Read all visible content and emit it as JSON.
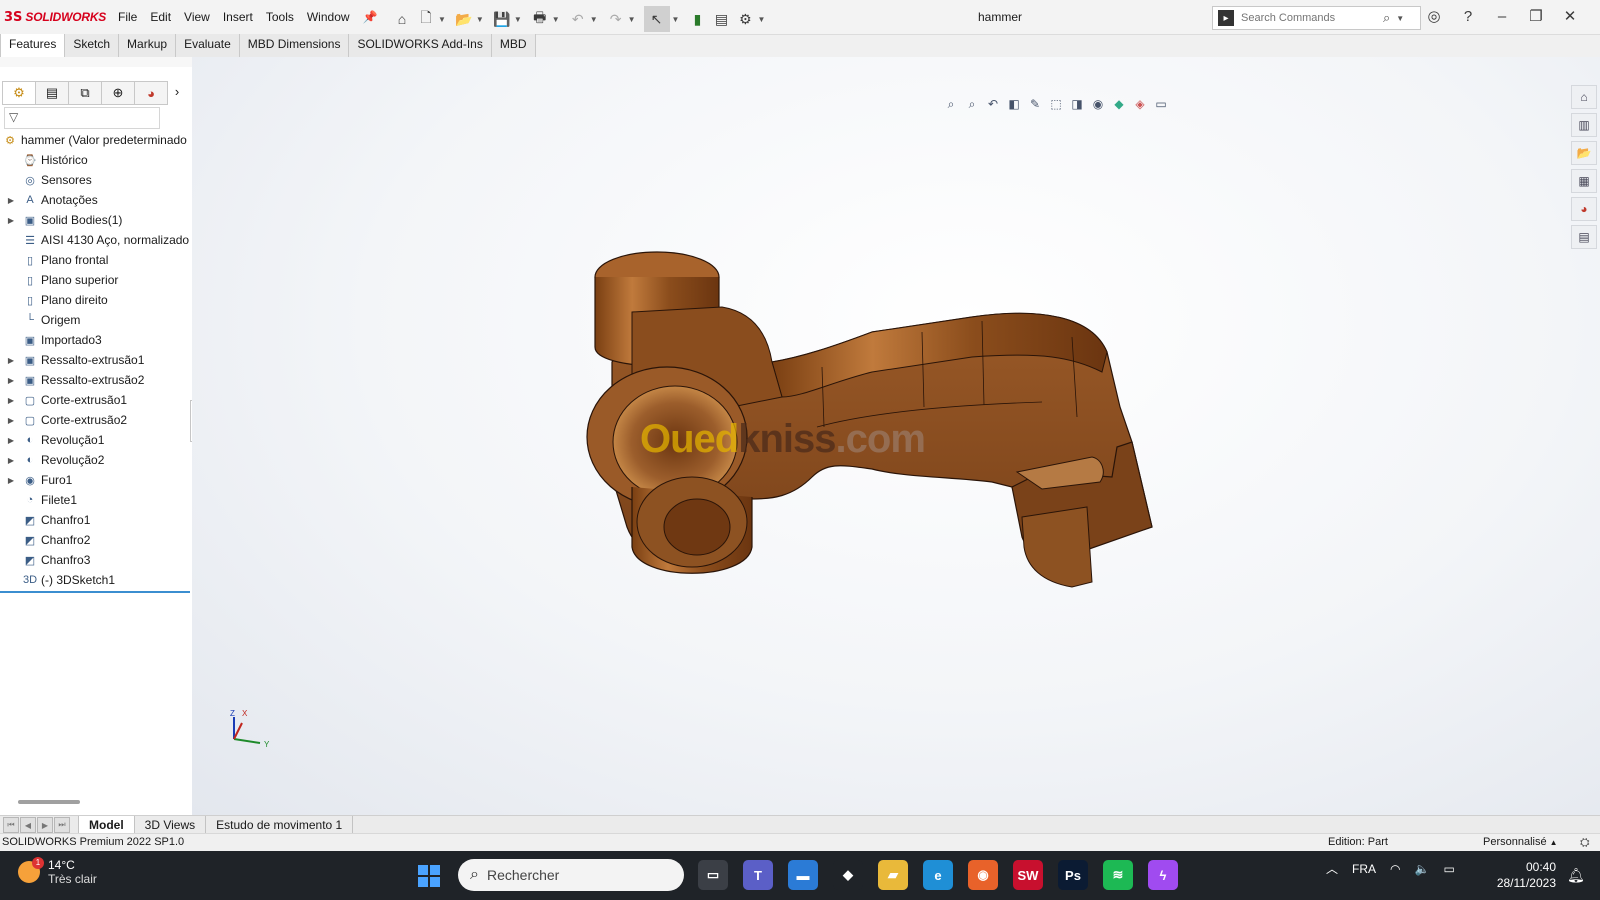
{
  "titlebar": {
    "brand_ds": "3S",
    "brand": "SOLIDWORKS",
    "menus": [
      "File",
      "Edit",
      "View",
      "Insert",
      "Tools",
      "Window"
    ],
    "document_title": "hammer",
    "search_placeholder": "Search Commands"
  },
  "command_tabs": [
    "Features",
    "Sketch",
    "Markup",
    "Evaluate",
    "MBD Dimensions",
    "SOLIDWORKS Add-Ins",
    "MBD"
  ],
  "feature_tree": {
    "root": "hammer  (Valor predeterminado",
    "items": [
      {
        "label": "Histórico",
        "expandable": false,
        "icon": "history-icon"
      },
      {
        "label": "Sensores",
        "expandable": false,
        "icon": "sensor-icon"
      },
      {
        "label": "Anotações",
        "expandable": true,
        "icon": "annotation-icon"
      },
      {
        "label": "Solid Bodies(1)",
        "expandable": true,
        "icon": "solid-bodies-icon"
      },
      {
        "label": "AISI 4130 Aço, normalizado",
        "expandable": false,
        "icon": "material-icon"
      },
      {
        "label": "Plano frontal",
        "expandable": false,
        "icon": "plane-icon"
      },
      {
        "label": "Plano superior",
        "expandable": false,
        "icon": "plane-icon"
      },
      {
        "label": "Plano direito",
        "expandable": false,
        "icon": "plane-icon"
      },
      {
        "label": "Origem",
        "expandable": false,
        "icon": "origin-icon"
      },
      {
        "label": "Importado3",
        "expandable": false,
        "icon": "imported-icon"
      },
      {
        "label": "Ressalto-extrusão1",
        "expandable": true,
        "icon": "boss-extrude-icon"
      },
      {
        "label": "Ressalto-extrusão2",
        "expandable": true,
        "icon": "boss-extrude-icon"
      },
      {
        "label": "Corte-extrusão1",
        "expandable": true,
        "icon": "cut-extrude-icon"
      },
      {
        "label": "Corte-extrusão2",
        "expandable": true,
        "icon": "cut-extrude-icon"
      },
      {
        "label": "Revolução1",
        "expandable": true,
        "icon": "revolve-icon"
      },
      {
        "label": "Revolução2",
        "expandable": true,
        "icon": "revolve-icon"
      },
      {
        "label": "Furo1",
        "expandable": true,
        "icon": "hole-icon"
      },
      {
        "label": "Filete1",
        "expandable": false,
        "icon": "fillet-icon"
      },
      {
        "label": "Chanfro1",
        "expandable": false,
        "icon": "chamfer-icon"
      },
      {
        "label": "Chanfro2",
        "expandable": false,
        "icon": "chamfer-icon"
      },
      {
        "label": "Chanfro3",
        "expandable": false,
        "icon": "chamfer-icon"
      },
      {
        "label": "(-) 3DSketch1",
        "expandable": false,
        "icon": "3d-sketch-icon"
      }
    ]
  },
  "viewport": {
    "watermark_a": "Oued",
    "watermark_b": "kniss",
    "watermark_c": ".com",
    "triad": {
      "x": "X",
      "y": "Y",
      "z": "Z"
    },
    "part_color": "#9a5a28"
  },
  "bottom_tabs": [
    "Model",
    "3D Views",
    "Estudo de movimento 1"
  ],
  "statusbar": {
    "left": "SOLIDWORKS Premium 2022 SP1.0",
    "edition": "Edition: Part",
    "custom": "Personnalisé"
  },
  "taskbar": {
    "weather_temp": "14°C",
    "weather_desc": "Très clair",
    "weather_badge": "1",
    "search": "Rechercher",
    "language": "FRA",
    "time": "00:40",
    "date": "28/11/2023",
    "apps": [
      {
        "name": "task-view-app",
        "glyph": "▭",
        "bg": "#3b3f46"
      },
      {
        "name": "teams-app",
        "glyph": "T",
        "bg": "#5b5fc7"
      },
      {
        "name": "desktop-app",
        "glyph": "▬",
        "bg": "#2b7bd6"
      },
      {
        "name": "anydesk-app",
        "glyph": "◆",
        "bg": "#1f2328"
      },
      {
        "name": "explorer-app",
        "glyph": "▰",
        "bg": "#e9b93a"
      },
      {
        "name": "edge-app",
        "glyph": "e",
        "bg": "#1f8fd6"
      },
      {
        "name": "firefox-app",
        "glyph": "◉",
        "bg": "#e8622a"
      },
      {
        "name": "solidworks-app",
        "glyph": "SW",
        "bg": "#c8102e"
      },
      {
        "name": "photoshop-app",
        "glyph": "Ps",
        "bg": "#0b1b33"
      },
      {
        "name": "spotify-app",
        "glyph": "≋",
        "bg": "#1db954"
      },
      {
        "name": "messenger-app",
        "glyph": "ϟ",
        "bg": "#a04bf0"
      }
    ]
  }
}
